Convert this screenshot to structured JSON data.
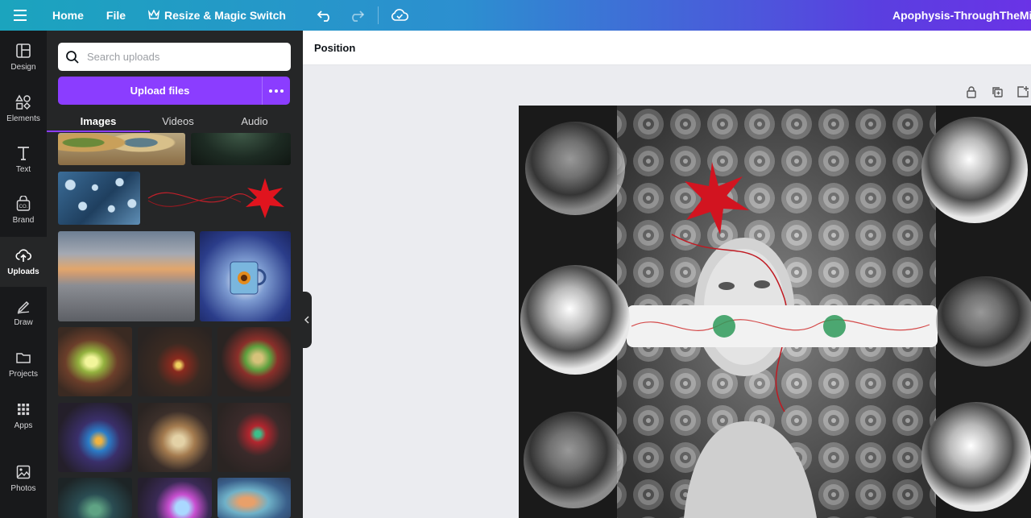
{
  "topbar": {
    "home": "Home",
    "file": "File",
    "resize": "Resize & Magic Switch",
    "doc_title": "Apophysis-ThroughTheMirro"
  },
  "rail": [
    {
      "label": "Design",
      "icon": "layout-icon"
    },
    {
      "label": "Elements",
      "icon": "shapes-icon"
    },
    {
      "label": "Text",
      "icon": "text-icon"
    },
    {
      "label": "Brand",
      "icon": "brand-icon"
    },
    {
      "label": "Uploads",
      "icon": "upload-cloud-icon"
    },
    {
      "label": "Draw",
      "icon": "pen-icon"
    },
    {
      "label": "Projects",
      "icon": "folder-icon"
    },
    {
      "label": "Apps",
      "icon": "grid-icon"
    },
    {
      "label": "Photos",
      "icon": "image-icon"
    }
  ],
  "uploads": {
    "search_placeholder": "Search uploads",
    "upload_button": "Upload files",
    "tabs": [
      "Images",
      "Videos",
      "Audio"
    ]
  },
  "editor": {
    "toolbar_label": "Position"
  },
  "colors": {
    "accent": "#8b3dff",
    "panel_bg": "#252627",
    "rail_bg": "#18191b"
  }
}
